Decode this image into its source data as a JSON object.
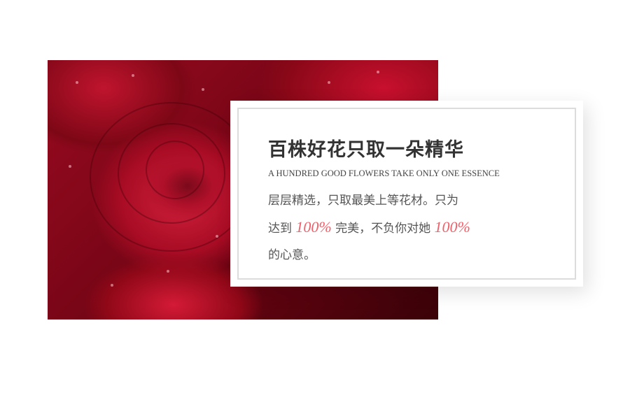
{
  "image": {
    "subject": "red-roses-photo"
  },
  "card": {
    "title": "百株好花只取一朵精华",
    "subtitle": "A HUNDRED GOOD FLOWERS TAKE ONLY ONE ESSENCE",
    "body_line1": "层层精选，只取最美上等花材。只为",
    "body_2a": "达到",
    "percent_1": "100%",
    "body_2b": "完美，不负你对她",
    "percent_2": "100%",
    "body_line3": "的心意。"
  },
  "colors": {
    "accent": "#f0606a",
    "rose": "#c8102e"
  }
}
